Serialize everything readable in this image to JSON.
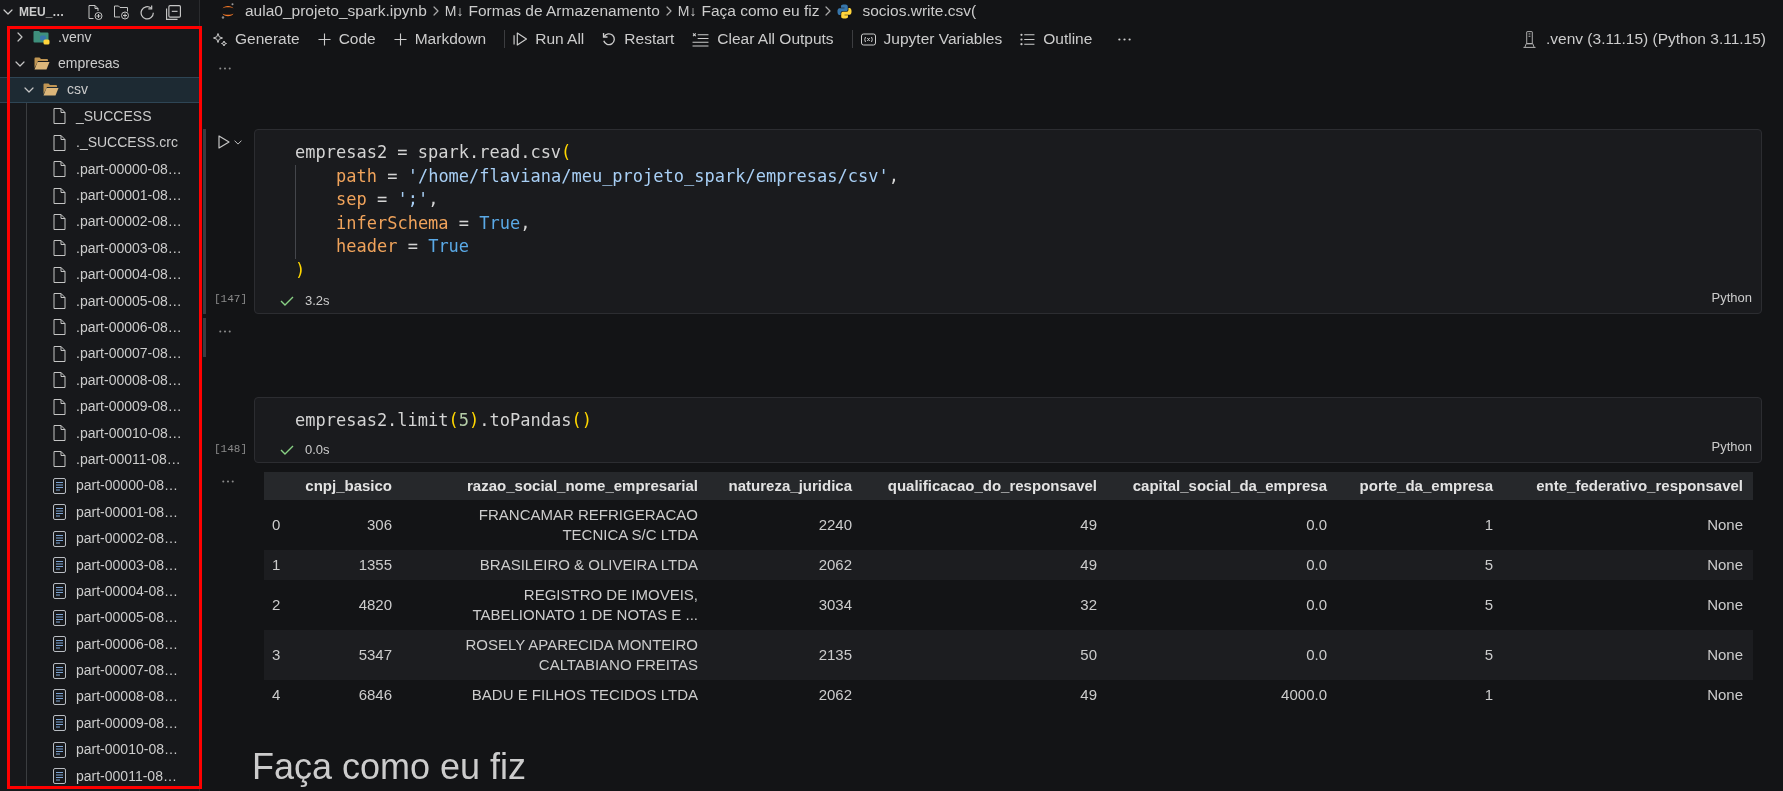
{
  "explorer": {
    "title": "MEU_…",
    "tree": [
      {
        "label": ".venv",
        "kind": "venv",
        "expanded": false,
        "selected": false
      },
      {
        "label": "empresas",
        "kind": "folder",
        "expanded": true,
        "selected": false,
        "children": [
          {
            "label": "csv",
            "kind": "folder",
            "expanded": true,
            "selected": true,
            "children": [
              {
                "label": "_SUCCESS",
                "kind": "file",
                "selected": false
              },
              {
                "label": "._SUCCESS.crc",
                "kind": "file",
                "selected": false
              },
              {
                "label": ".part-00000-08…",
                "kind": "file",
                "selected": false
              },
              {
                "label": ".part-00001-08…",
                "kind": "file",
                "selected": false
              },
              {
                "label": ".part-00002-08…",
                "kind": "file",
                "selected": false
              },
              {
                "label": ".part-00003-08…",
                "kind": "file",
                "selected": false
              },
              {
                "label": ".part-00004-08…",
                "kind": "file",
                "selected": false
              },
              {
                "label": ".part-00005-08…",
                "kind": "file",
                "selected": false
              },
              {
                "label": ".part-00006-08…",
                "kind": "file",
                "selected": false
              },
              {
                "label": ".part-00007-08…",
                "kind": "file",
                "selected": false
              },
              {
                "label": ".part-00008-08…",
                "kind": "file",
                "selected": false
              },
              {
                "label": ".part-00009-08…",
                "kind": "file",
                "selected": false
              },
              {
                "label": ".part-00010-08…",
                "kind": "file",
                "selected": false
              },
              {
                "label": ".part-00011-08…",
                "kind": "file",
                "selected": false
              },
              {
                "label": "part-00000-08…",
                "kind": "document",
                "selected": false
              },
              {
                "label": "part-00001-08…",
                "kind": "document",
                "selected": false
              },
              {
                "label": "part-00002-08…",
                "kind": "document",
                "selected": false
              },
              {
                "label": "part-00003-08…",
                "kind": "document",
                "selected": false
              },
              {
                "label": "part-00004-08…",
                "kind": "document",
                "selected": false
              },
              {
                "label": "part-00005-08…",
                "kind": "document",
                "selected": false
              },
              {
                "label": "part-00006-08…",
                "kind": "document",
                "selected": false
              },
              {
                "label": "part-00007-08…",
                "kind": "document",
                "selected": false
              },
              {
                "label": "part-00008-08…",
                "kind": "document",
                "selected": false
              },
              {
                "label": "part-00009-08…",
                "kind": "document",
                "selected": false
              },
              {
                "label": "part-00010-08…",
                "kind": "document",
                "selected": false
              },
              {
                "label": "part-00011-08…",
                "kind": "document",
                "selected": false
              }
            ]
          }
        ]
      }
    ]
  },
  "breadcrumbs": [
    {
      "kind": "notebook",
      "label": "aula0_projeto_spark.ipynb"
    },
    {
      "kind": "markdown",
      "icon": "M↓",
      "label": "Formas de Armazenamento"
    },
    {
      "kind": "markdown",
      "icon": "M↓",
      "label": "Faça como eu fiz"
    },
    {
      "kind": "python",
      "label": "socios.write.csv("
    }
  ],
  "toolbar": [
    {
      "kind": "generate",
      "label": "Generate"
    },
    {
      "kind": "add",
      "label": "Code"
    },
    {
      "kind": "add",
      "label": "Markdown"
    },
    {
      "kind": "separator"
    },
    {
      "kind": "run_all",
      "label": "Run All"
    },
    {
      "kind": "restart",
      "label": "Restart"
    },
    {
      "kind": "clear",
      "label": "Clear All Outputs"
    },
    {
      "kind": "separator"
    },
    {
      "kind": "variables",
      "label": "Jupyter Variables"
    },
    {
      "kind": "outline",
      "label": "Outline"
    },
    {
      "kind": "more"
    }
  ],
  "kernel": {
    "label": ".venv (3.11.15) (Python 3.11.15)"
  },
  "cells": [
    {
      "kind": "code",
      "selected": true,
      "execution_count": "[147]",
      "succeeded": true,
      "duration": "3.2s",
      "language": "Python",
      "lines": [
        {
          "indent": false,
          "tokens": [
            {
              "kind": "plain",
              "text": "empresas2 = spark.read.csv"
            },
            {
              "kind": "bracket",
              "text": "("
            }
          ]
        },
        {
          "indent": true,
          "tokens": [
            {
              "kind": "param",
              "text": "path"
            },
            {
              "kind": "plain",
              "text": " = "
            },
            {
              "kind": "string",
              "text": "'/home/flaviana/meu_projeto_spark/empresas/csv'"
            },
            {
              "kind": "plain",
              "text": ","
            }
          ]
        },
        {
          "indent": true,
          "tokens": [
            {
              "kind": "param",
              "text": "sep"
            },
            {
              "kind": "plain",
              "text": " = "
            },
            {
              "kind": "string",
              "text": "';'"
            },
            {
              "kind": "plain",
              "text": ","
            }
          ]
        },
        {
          "indent": true,
          "tokens": [
            {
              "kind": "param",
              "text": "inferSchema"
            },
            {
              "kind": "plain",
              "text": " = "
            },
            {
              "kind": "const",
              "text": "True"
            },
            {
              "kind": "plain",
              "text": ","
            }
          ]
        },
        {
          "indent": true,
          "tokens": [
            {
              "kind": "param",
              "text": "header"
            },
            {
              "kind": "plain",
              "text": " = "
            },
            {
              "kind": "const",
              "text": "True"
            }
          ]
        },
        {
          "indent": false,
          "tokens": [
            {
              "kind": "bracket",
              "text": ")"
            }
          ]
        }
      ],
      "output": {
        "kind": "collapsed"
      }
    },
    {
      "kind": "code",
      "selected": false,
      "execution_count": "[148]",
      "succeeded": true,
      "duration": "0.0s",
      "language": "Python",
      "lines": [
        {
          "indent": false,
          "tokens": [
            {
              "kind": "plain",
              "text": "empresas2.limit"
            },
            {
              "kind": "bracket",
              "text": "("
            },
            {
              "kind": "number",
              "text": "5"
            },
            {
              "kind": "bracket",
              "text": ")"
            },
            {
              "kind": "plain",
              "text": ".toPandas"
            },
            {
              "kind": "bracket",
              "text": "()"
            }
          ]
        }
      ],
      "output": {
        "kind": "table",
        "columns": [
          "cnpj_basico",
          "razao_social_nome_empresarial",
          "natureza_juridica",
          "qualificacao_do_responsavel",
          "capital_social_da_empresa",
          "porte_da_empresa",
          "ente_federativo_responsavel"
        ],
        "rows": [
          {
            "index": "0",
            "cells": [
              "306",
              "FRANCAMAR REFRIGERACAO TECNICA S/C LTDA",
              "2240",
              "49",
              "0.0",
              "1",
              "None"
            ]
          },
          {
            "index": "1",
            "cells": [
              "1355",
              "BRASILEIRO & OLIVEIRA LTDA",
              "2062",
              "49",
              "0.0",
              "5",
              "None"
            ]
          },
          {
            "index": "2",
            "cells": [
              "4820",
              "REGISTRO DE IMOVEIS, TABELIONATO 1 DE NOTAS E ...",
              "3034",
              "32",
              "0.0",
              "5",
              "None"
            ]
          },
          {
            "index": "3",
            "cells": [
              "5347",
              "ROSELY APARECIDA MONTEIRO CALTABIANO FREITAS",
              "2135",
              "50",
              "0.0",
              "5",
              "None"
            ]
          },
          {
            "index": "4",
            "cells": [
              "6846",
              "BADU E FILHOS TECIDOS LTDA",
              "2062",
              "49",
              "4000.0",
              "1",
              "None"
            ]
          }
        ]
      }
    },
    {
      "kind": "markdown",
      "heading": "Faça como eu fiz"
    }
  ]
}
